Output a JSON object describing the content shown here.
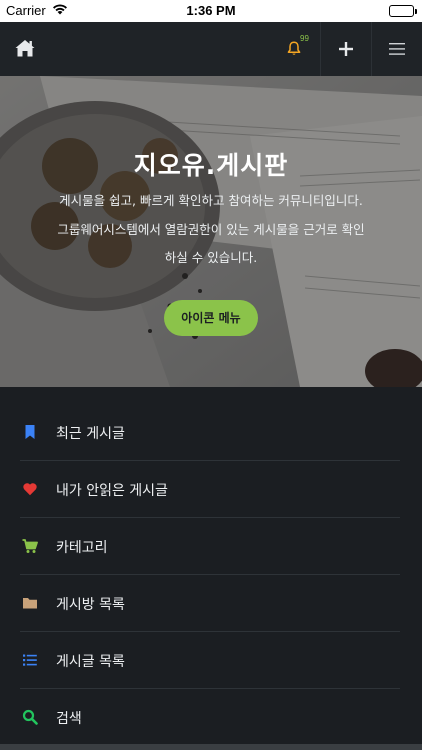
{
  "status_bar": {
    "carrier": "Carrier",
    "time": "1:36 PM"
  },
  "navbar": {
    "notification_count": "99",
    "icons": [
      "home-icon",
      "bell-icon",
      "plus-icon",
      "hamburger-icon"
    ],
    "bell_color": "#f5a623",
    "badge_color": "#8bc34a"
  },
  "hero": {
    "title": "지오유.게시판",
    "description_lines": [
      "게시물을 쉽고, 빠르게 확인하고 참여하는 커뮤니티입니다.",
      "그룹웨어시스템에서 열람권한이 있는 게시물을 근거로 확인",
      "하실 수 있습니다."
    ],
    "button_label": "아이콘 메뉴",
    "button_color": "#8bc34a"
  },
  "menu": {
    "items": [
      {
        "label": "최근 게시글",
        "icon": "bookmark-icon",
        "color": "#3b82f6"
      },
      {
        "label": "내가 안읽은 게시글",
        "icon": "heart-icon",
        "color": "#e53935"
      },
      {
        "label": "카테고리",
        "icon": "cart-icon",
        "color": "#8bc34a"
      },
      {
        "label": "게시방 목록",
        "icon": "folder-icon",
        "color": "#c8a27a"
      },
      {
        "label": "게시글 목록",
        "icon": "list-icon",
        "color": "#3b82f6"
      },
      {
        "label": "검색",
        "icon": "search-icon",
        "color": "#22c55e"
      }
    ]
  }
}
